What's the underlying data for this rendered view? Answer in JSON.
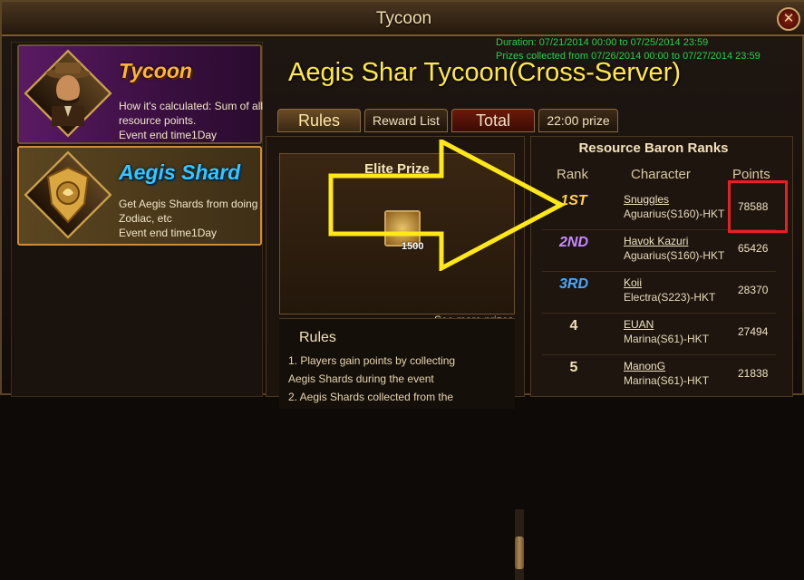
{
  "window": {
    "title": "Tycoon",
    "close_label": "✕"
  },
  "sidebar": {
    "items": [
      {
        "title": "Tycoon",
        "desc": "How it's calculated: Sum of all resource points.",
        "end": "Event end time1Day"
      },
      {
        "title": "Aegis Shard",
        "desc": "Get Aegis Shards from doing Zodiac, etc",
        "end": "Event end time1Day"
      }
    ]
  },
  "header": {
    "duration": "Duration: 07/21/2014 00:00 to 07/25/2014 23:59",
    "prizes_collected": "Prizes collected from 07/26/2014 00:00 to 07/27/2014 23:59",
    "title": "Aegis Shar Tycoon(Cross-Server)"
  },
  "tabs": [
    {
      "label": "Rules"
    },
    {
      "label": "Reward List"
    },
    {
      "label": "Total"
    },
    {
      "label": "22:00 prize"
    }
  ],
  "prize": {
    "title": "Elite Prize",
    "item_count": "1500",
    "see_more": "See more prizes",
    "rules_title": "Rules",
    "rules_lines": [
      "1. Players gain points by collecting",
      "Aegis Shards during the event",
      "2. Aegis Shards collected from the"
    ]
  },
  "ranks": {
    "title": "Resource Baron Ranks",
    "columns": [
      "Rank",
      "Character",
      "Points"
    ],
    "rows": [
      {
        "rank": "1ST",
        "name": "Snuggles",
        "server": "Aguarius(S160)-HKT",
        "points": "78588",
        "color": "#ffd24a"
      },
      {
        "rank": "2ND",
        "name": "Havok Kazuri",
        "server": "Aguarius(S160)-HKT",
        "points": "65426",
        "color": "#c78bff"
      },
      {
        "rank": "3RD",
        "name": "Koii",
        "server": "Electra(S223)-HKT",
        "points": "28370",
        "color": "#4aa8ff"
      },
      {
        "rank": "4",
        "name": "EUAN",
        "server": "Marina(S61)-HKT",
        "points": "27494",
        "color": "#f0e0b8"
      },
      {
        "rank": "5",
        "name": "ManonG",
        "server": "Marina(S61)-HKT",
        "points": "21838",
        "color": "#f0e0b8"
      }
    ]
  },
  "colors": {
    "accent_yellow": "#ffe94a",
    "highlight_red": "#e82020",
    "duration_green": "#27d04a"
  }
}
